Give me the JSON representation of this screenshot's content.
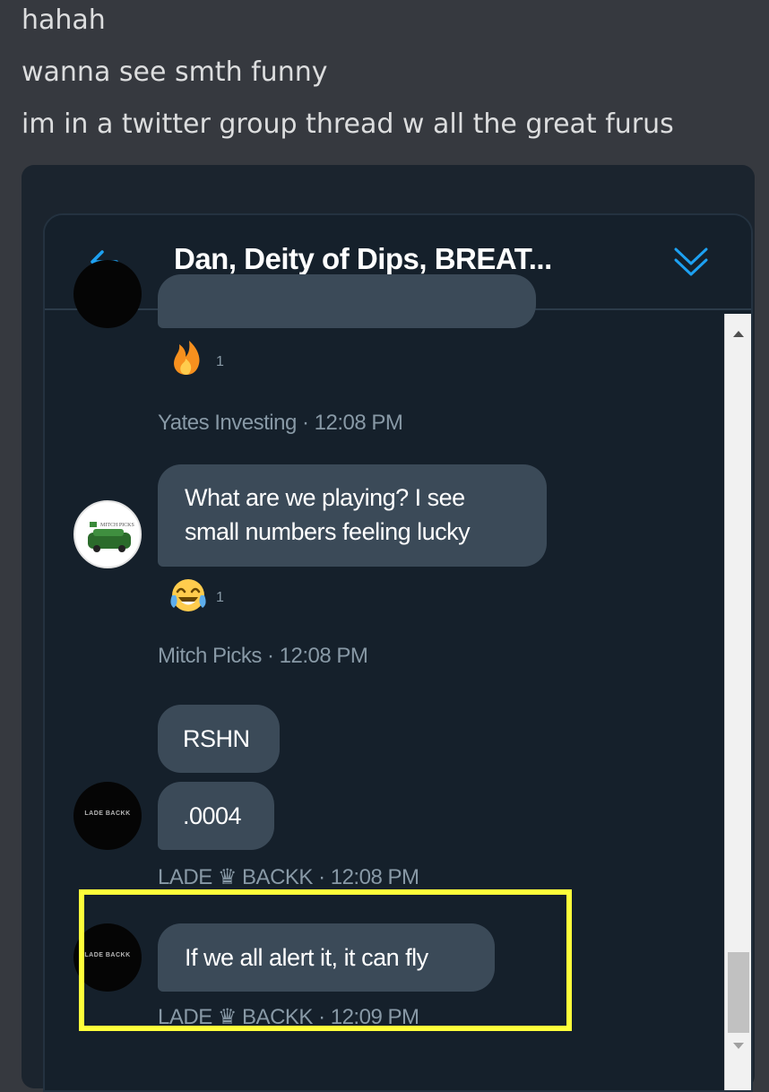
{
  "discord_messages": [
    "hahah",
    "wanna see smth funny",
    "im in a twitter group thread w all the great furus"
  ],
  "dm": {
    "title": "Dan, Deity of Dips, BREAT...",
    "messages": [
      {
        "reaction_emoji": "🔥",
        "reaction_count": "1",
        "meta": "Yates Investing · 12:08 PM"
      },
      {
        "avatar_label": "MITCH PICKS",
        "lines": [
          "What are we playing? I see",
          "small numbers feeling lucky"
        ],
        "reaction_emoji": "😂",
        "reaction_count": "1",
        "meta": "Mitch Picks · 12:08 PM"
      },
      {
        "avatar_label": "LADE BACKK",
        "bubbles": [
          "RSHN",
          ".0004"
        ],
        "meta": "LADE ♛ BACKK · 12:08 PM"
      },
      {
        "avatar_label": "LADE BACKK",
        "text": "If we all alert it, it can fly",
        "meta": "LADE ♛ BACKK · 12:09 PM"
      }
    ]
  },
  "colors": {
    "discord_bg": "#36393f",
    "twitter_bg": "#15202b",
    "bubble": "#3b4a58",
    "accent": "#1da1f2",
    "highlight": "#ffff3a"
  },
  "icons": [
    "back-arrow-icon",
    "collapse-chevrons-icon",
    "fire-emoji",
    "tears-of-joy-emoji",
    "crown-icon",
    "scroll-up-icon",
    "scroll-down-icon"
  ]
}
